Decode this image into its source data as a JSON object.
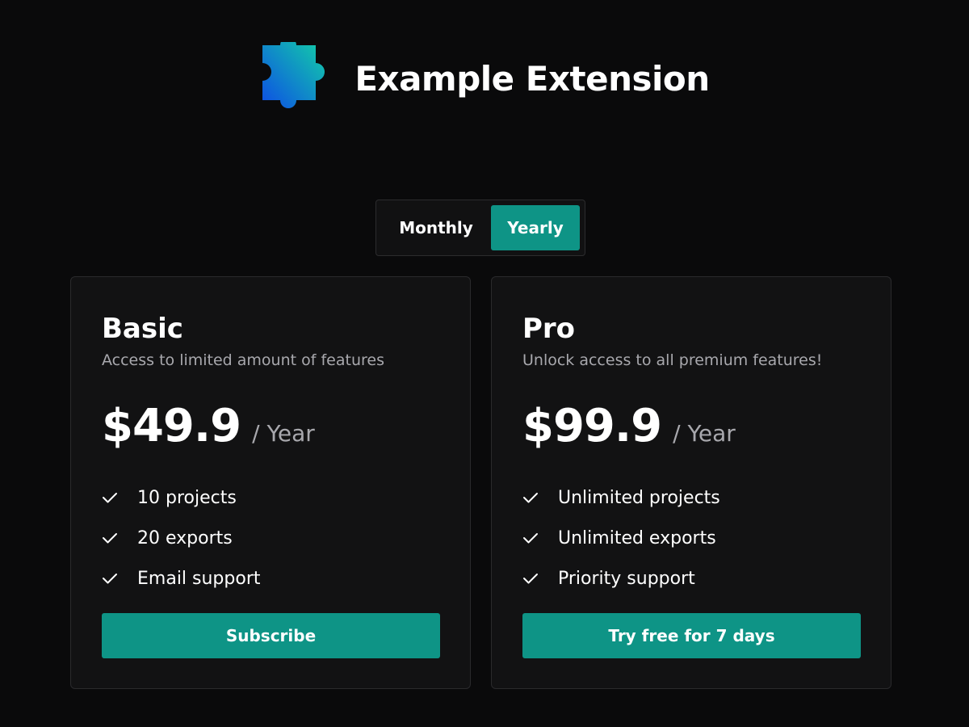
{
  "app": {
    "title": "Example Extension",
    "logo_icon": "puzzle-piece-icon",
    "logo_gradient": [
      "#13d3a5",
      "#0d4de6"
    ]
  },
  "billing_toggle": {
    "monthly_label": "Monthly",
    "yearly_label": "Yearly",
    "selected": "Yearly",
    "accent_color": "#0e9486"
  },
  "plans": [
    {
      "name": "Basic",
      "description": "Access to limited amount of features",
      "price": "$49.9",
      "period": "/ Year",
      "features": [
        "10 projects",
        "20 exports",
        "Email support"
      ],
      "feature_icon": "check-icon",
      "cta_label": "Subscribe"
    },
    {
      "name": "Pro",
      "description": "Unlock access to all premium features!",
      "price": "$99.9",
      "period": "/ Year",
      "features": [
        "Unlimited projects",
        "Unlimited exports",
        "Priority support"
      ],
      "feature_icon": "check-icon",
      "cta_label": "Try free for 7 days"
    }
  ]
}
